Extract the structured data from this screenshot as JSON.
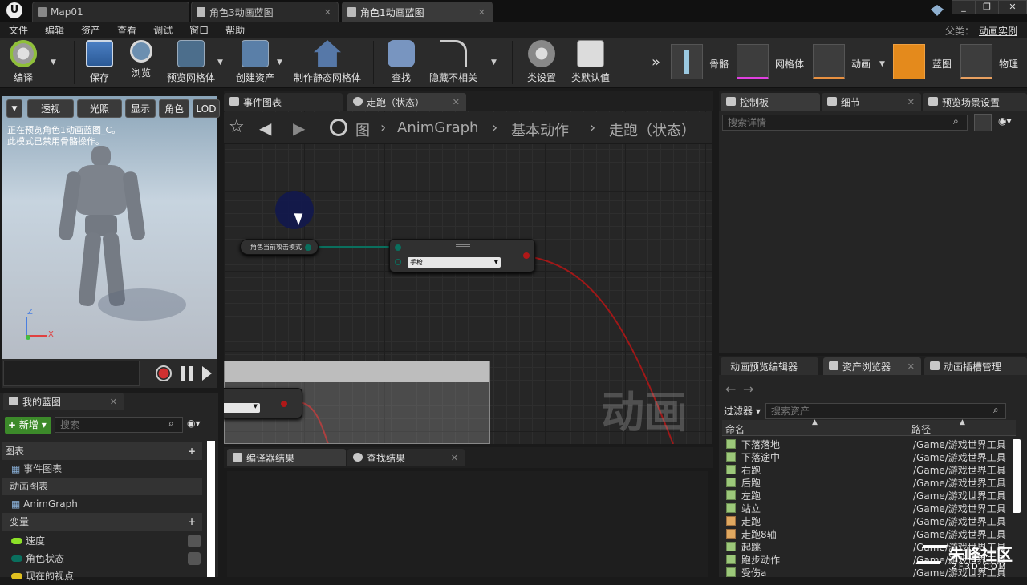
{
  "tabs": [
    {
      "label": "Map01"
    },
    {
      "label": "角色3动画蓝图"
    },
    {
      "label": "角色1动画蓝图"
    }
  ],
  "parent_class": {
    "label": "父类：",
    "value": "动画实例"
  },
  "menu": [
    "文件",
    "编辑",
    "资产",
    "查看",
    "调试",
    "窗口",
    "帮助"
  ],
  "toolbar": {
    "compile": "编译",
    "save": "保存",
    "browse": "浏览",
    "preview_mesh": "预览网格体",
    "create_asset": "创建资产",
    "make_static_mesh": "制作静态网格体",
    "find": "查找",
    "hide_unrelated": "隐藏不相关",
    "class_settings": "类设置",
    "class_defaults": "类默认值"
  },
  "modes": [
    "骨骼",
    "网格体",
    "动画",
    "蓝图",
    "物理"
  ],
  "viewport": {
    "buttons": [
      "透视",
      "光照",
      "显示",
      "角色",
      "LOD"
    ],
    "info_line1": "正在预览角色1动画蓝图_C。",
    "info_line2": "此模式已禁用骨骼操作。"
  },
  "graph_tabs": [
    "事件图表",
    "走跑（状态）"
  ],
  "breadcrumb": [
    "图",
    "AnimGraph",
    "基本动作",
    "走跑（状态）"
  ],
  "graph": {
    "var_node": "角色当前攻击模式",
    "enum_value": "手枪",
    "watermark": "动画"
  },
  "my_blueprint": {
    "title": "我的蓝图",
    "add_button": "新增",
    "search_placeholder": "搜索",
    "sections": {
      "graphs": "图表",
      "event_graph": "事件图表",
      "anim_graphs": "动画图表",
      "anim_graph": "AnimGraph",
      "variables": "变量"
    },
    "vars": [
      "速度",
      "角色状态",
      "现在的视点"
    ]
  },
  "bottom_tabs": [
    "编译器结果",
    "查找结果"
  ],
  "right_tabs": [
    "控制板",
    "细节",
    "预览场景设置"
  ],
  "details_search": "搜索详情",
  "assets_tabs": [
    "动画预览编辑器",
    "资产浏览器",
    "动画插槽管理"
  ],
  "assets": {
    "filter": "过滤器",
    "search_placeholder": "搜索资产",
    "col_name": "命名",
    "col_path": "路径",
    "rows": [
      {
        "name": "下落落地",
        "path": "/Game/游戏世界工具"
      },
      {
        "name": "下落途中",
        "path": "/Game/游戏世界工具"
      },
      {
        "name": "右跑",
        "path": "/Game/游戏世界工具"
      },
      {
        "name": "后跑",
        "path": "/Game/游戏世界工具"
      },
      {
        "name": "左跑",
        "path": "/Game/游戏世界工具"
      },
      {
        "name": "站立",
        "path": "/Game/游戏世界工具"
      },
      {
        "name": "走跑",
        "path": "/Game/游戏世界工具"
      },
      {
        "name": "走跑8轴",
        "path": "/Game/游戏世界工具"
      },
      {
        "name": "起跳",
        "path": "/Game/游戏世界工具"
      },
      {
        "name": "跑步动作",
        "path": "/Game/游戏世界工具"
      },
      {
        "name": "受伤a",
        "path": "/Game/游戏世界工具"
      }
    ]
  },
  "brand": {
    "main": "朱峰社区",
    "sub": "ZF3D.COM"
  }
}
